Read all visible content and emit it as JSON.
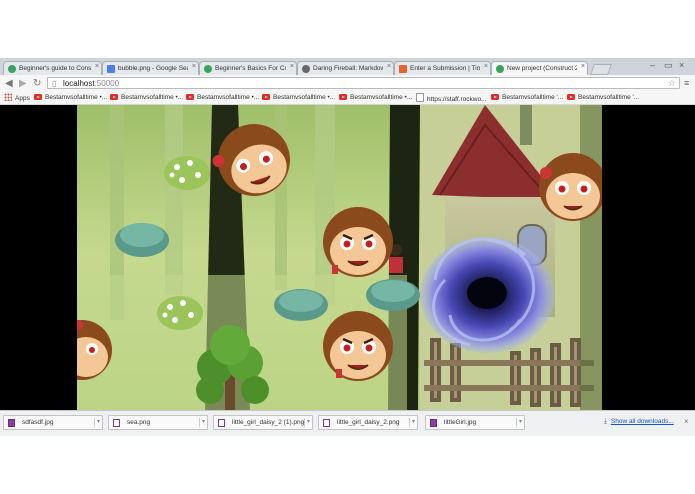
{
  "tabs": [
    {
      "title": "Beginner's guide to Cons",
      "favicon_color": "#3aa35c"
    },
    {
      "title": "bubble.png - Google Sear",
      "favicon_color": "#4a80e8"
    },
    {
      "title": "Beginner's Basics For Con",
      "favicon_color": "#3aa35c"
    },
    {
      "title": "Daring Fireball: Markdow",
      "favicon_color": "#666666"
    },
    {
      "title": "Enter a Submission | Tine",
      "favicon_color": "#e0662a"
    },
    {
      "title": "New project (Construct 2",
      "favicon_color": "#3aa35c"
    }
  ],
  "toolbar": {
    "back_icon": "◀",
    "forward_icon": "▶",
    "reload_icon": "↻",
    "url_host": "localhost",
    "url_port": ":50000",
    "star_icon": "☆",
    "menu_icon": "≡"
  },
  "bookmarks": [
    {
      "label": "Apps",
      "icon": "apps-icon"
    },
    {
      "label": "Bestamvsofalltime •...",
      "icon": "youtube-icon"
    },
    {
      "label": "Bestamvsofalltime •...",
      "icon": "youtube-icon"
    },
    {
      "label": "Bestamvsofalltime •...",
      "icon": "youtube-icon"
    },
    {
      "label": "Bestamvsofalltime •...",
      "icon": "youtube-icon"
    },
    {
      "label": "Bestamvsofalltime •...",
      "icon": "youtube-icon"
    },
    {
      "label": "https://staff.rockwo...",
      "icon": "page-icon"
    },
    {
      "label": "Bestamvsofalltime '...",
      "icon": "youtube-icon"
    },
    {
      "label": "Bestamvsofalltime '...",
      "icon": "youtube-icon"
    }
  ],
  "downloads": [
    {
      "filename": "sdfasdf.jpg",
      "icon": "image-file-icon"
    },
    {
      "filename": "sea.png",
      "icon": "file-icon"
    },
    {
      "filename": "little_girl_daisy_2 (1).png",
      "icon": "file-icon"
    },
    {
      "filename": "little_girl_daisy_2.png",
      "icon": "file-icon"
    },
    {
      "filename": "littleGirl.jpg",
      "icon": "image-file-icon"
    }
  ],
  "show_all_downloads": "Show all downloads...",
  "colors": {
    "forest_green": "#bcd38a",
    "monkey_brown": "#8b4a1c",
    "monkey_face": "#f3c796",
    "portal_blue": "#4a4ab8",
    "roof_red": "#8c2e2e"
  }
}
